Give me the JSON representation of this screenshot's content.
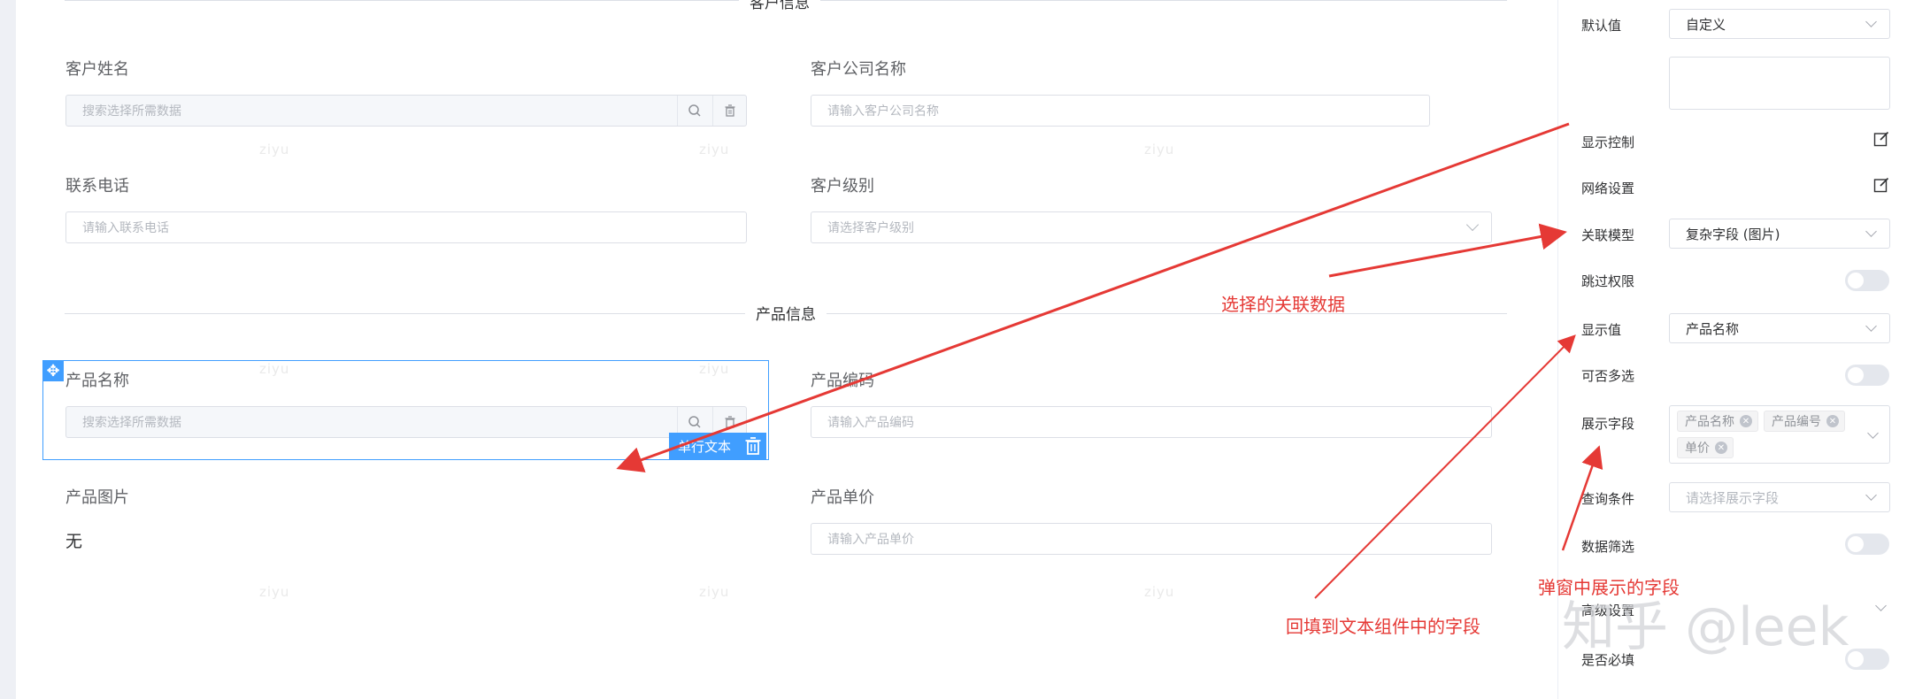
{
  "form": {
    "sections": [
      {
        "title": "客户信息"
      },
      {
        "title": "产品信息"
      }
    ],
    "fields": {
      "customer_name": {
        "label": "客户姓名",
        "placeholder": "搜索选择所需数据"
      },
      "customer_company": {
        "label": "客户公司名称",
        "placeholder": "请输入客户公司名称"
      },
      "phone": {
        "label": "联系电话",
        "placeholder": "请输入联系电话"
      },
      "customer_level": {
        "label": "客户级别",
        "placeholder": "请选择客户级别"
      },
      "product_name": {
        "label": "产品名称",
        "placeholder": "搜索选择所需数据"
      },
      "product_code": {
        "label": "产品编码",
        "placeholder": "请输入产品编码"
      },
      "product_image": {
        "label": "产品图片",
        "value": "无"
      },
      "product_price": {
        "label": "产品单价",
        "placeholder": "请输入产品单价"
      }
    },
    "selected_component": {
      "toolbar_label": "单行文本"
    },
    "watermark_text": "ziyu"
  },
  "panel": {
    "default_value": {
      "label": "默认值",
      "value": "自定义"
    },
    "display_control": {
      "label": "显示控制"
    },
    "grid_settings": {
      "label": "网络设置"
    },
    "linked_model": {
      "label": "关联模型",
      "value": "复杂字段 (图片)"
    },
    "skip_permission": {
      "label": "跳过权限"
    },
    "display_value": {
      "label": "显示值",
      "value": "产品名称"
    },
    "multi_select": {
      "label": "可否多选"
    },
    "display_fields": {
      "label": "展示字段",
      "tags": [
        "产品名称",
        "产品编号",
        "单价"
      ]
    },
    "query_conditions": {
      "label": "查询条件",
      "placeholder": "请选择展示字段"
    },
    "data_filter": {
      "label": "数据筛选"
    },
    "advanced_settings": {
      "label": "高级设置"
    },
    "required": {
      "label": "是否必填"
    }
  },
  "annotations": {
    "selected_link_data": "选择的关联数据",
    "popup_fields": "弹窗中展示的字段",
    "backfill_field": "回填到文本组件中的字段"
  },
  "zhihu_watermark": "知乎 @leek",
  "colors": {
    "accent": "#409eff",
    "annotation": "#e53935"
  }
}
